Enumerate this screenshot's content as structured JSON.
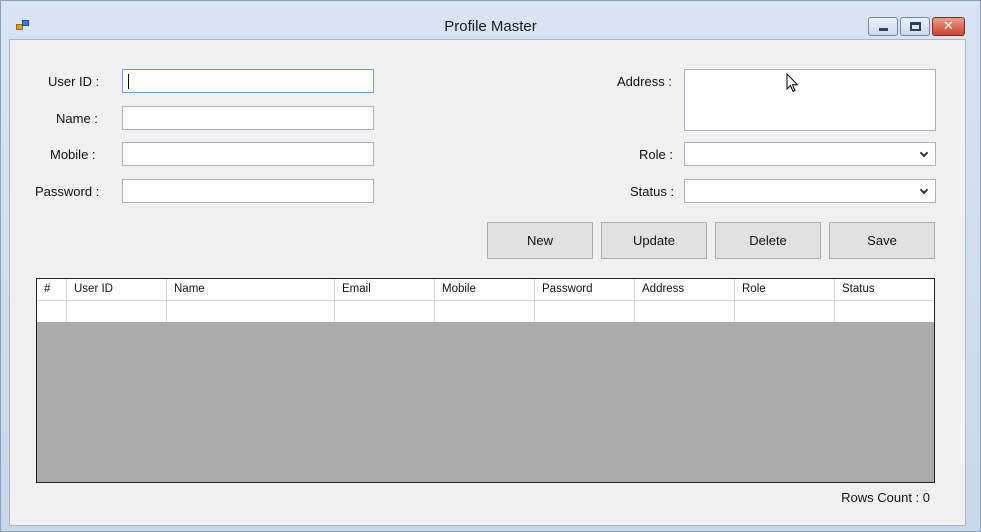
{
  "window": {
    "title": "Profile Master"
  },
  "form": {
    "user_id": {
      "label": "User ID :",
      "value": ""
    },
    "name": {
      "label": "Name :",
      "value": ""
    },
    "mobile": {
      "label": "Mobile :",
      "value": ""
    },
    "password": {
      "label": "Password :",
      "value": ""
    },
    "address": {
      "label": "Address :",
      "value": ""
    },
    "role": {
      "label": "Role :",
      "value": ""
    },
    "status": {
      "label": "Status :",
      "value": ""
    }
  },
  "buttons": {
    "new": "New",
    "update": "Update",
    "delete": "Delete",
    "save": "Save"
  },
  "grid": {
    "columns": [
      "#",
      "User ID",
      "Name",
      "Email",
      "Mobile",
      "Password",
      "Address",
      "Role",
      "Status"
    ]
  },
  "footer": {
    "rows_count": "Rows Count : 0"
  },
  "icons": {
    "app": "app-icon",
    "minimize": "minimize-icon",
    "maximize": "maximize-icon",
    "close": "close-icon",
    "dropdown": "chevron-down-icon"
  }
}
